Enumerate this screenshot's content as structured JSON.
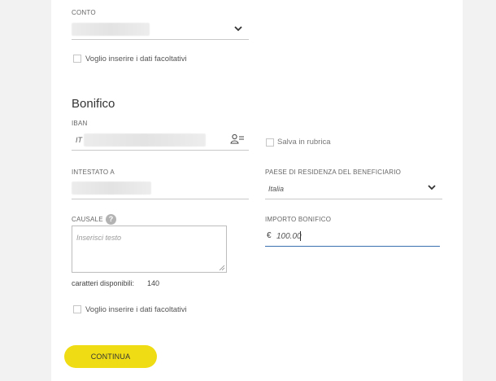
{
  "account": {
    "label": "CONTO",
    "optional_checkbox_label": "Voglio inserire i dati facoltativi"
  },
  "transfer": {
    "title": "Bonifico",
    "iban": {
      "label": "IBAN",
      "prefix": "IT",
      "icon": "address-book-icon"
    },
    "save_to_contacts_label": "Salva in rubrica",
    "holder": {
      "label": "INTESTATO A"
    },
    "residence_country": {
      "label": "PAESE DI RESIDENZA DEL BENEFICIARIO",
      "value": "Italia"
    },
    "reason": {
      "label": "CAUSALE",
      "help": "?",
      "placeholder": "Inserisci testo",
      "chars_available_label": "caratteri disponibili:",
      "chars_available_value": "140"
    },
    "amount": {
      "label": "IMPORTO BONIFICO",
      "currency": "€",
      "value": "100.00"
    },
    "optional_checkbox_label": "Voglio inserire i dati facoltativi"
  },
  "continue_button": "CONTINUA",
  "colors": {
    "accent": "#f0dc14",
    "focus_underline": "#3a6fb0"
  }
}
